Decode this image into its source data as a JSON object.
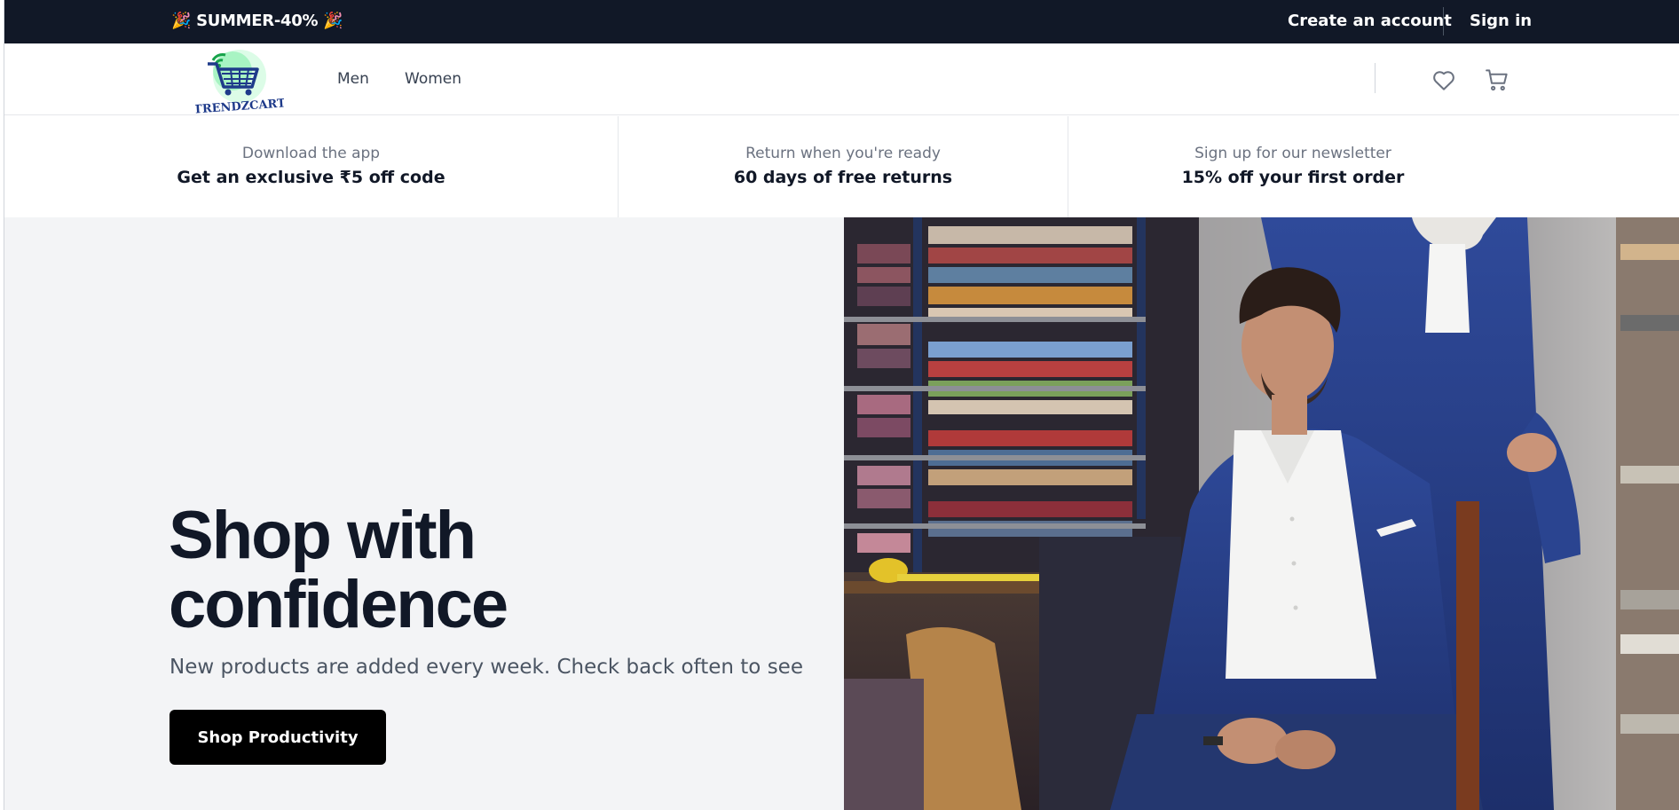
{
  "promo": {
    "code_text": "🎉 SUMMER-40% 🎉",
    "create_account": "Create an account",
    "sign_in": "Sign in"
  },
  "header": {
    "logo_text": "TRENDZCART",
    "nav": [
      "Men",
      "Women"
    ],
    "icons": [
      "heart-icon",
      "cart-icon"
    ]
  },
  "perks": [
    {
      "subtitle": "Download the app",
      "title": "Get an exclusive ₹5 off code"
    },
    {
      "subtitle": "Return when you're ready",
      "title": "60 days of free returns"
    },
    {
      "subtitle": "Sign up for our newsletter",
      "title": "15% off your first order"
    }
  ],
  "hero": {
    "title_line1": "Shop with",
    "title_line2": "confidence",
    "subtitle": "New products are added every week. Check back often to see",
    "cta": "Shop Productivity"
  },
  "colors": {
    "promo_bg": "#111827",
    "hero_bg": "#f3f4f6",
    "cta_bg": "#000000",
    "logo_green": "#22c55e",
    "logo_navy": "#1e3a8a"
  }
}
